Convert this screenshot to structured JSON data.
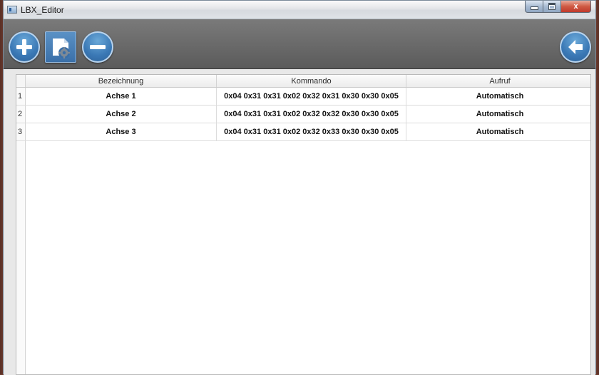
{
  "window": {
    "title": "LBX_Editor"
  },
  "window_controls": {
    "minimize": "minimize",
    "maximize": "maximize",
    "close": "x"
  },
  "toolbar": {
    "buttons": [
      {
        "name": "add",
        "icon": "plus-circle-icon"
      },
      {
        "name": "edit-settings",
        "icon": "document-gear-icon"
      },
      {
        "name": "remove",
        "icon": "minus-circle-icon"
      },
      {
        "name": "back",
        "icon": "arrow-left-circle-icon"
      }
    ]
  },
  "table": {
    "columns": [
      "Bezeichnung",
      "Kommando",
      "Aufruf"
    ],
    "rows": [
      {
        "num": "1",
        "bezeichnung": "Achse 1",
        "kommando": "0x04 0x31 0x31 0x02 0x32 0x31 0x30 0x30 0x05",
        "aufruf": "Automatisch"
      },
      {
        "num": "2",
        "bezeichnung": "Achse 2",
        "kommando": "0x04 0x31 0x31 0x02 0x32 0x32 0x30 0x30 0x05",
        "aufruf": "Automatisch"
      },
      {
        "num": "3",
        "bezeichnung": "Achse 3",
        "kommando": "0x04 0x31 0x31 0x02 0x32 0x33 0x30 0x30 0x05",
        "aufruf": "Automatisch"
      }
    ]
  },
  "colors": {
    "toolbar_bg": "#5b5b5b",
    "button_blue": "#3a78b5",
    "close_red": "#c0392b"
  }
}
